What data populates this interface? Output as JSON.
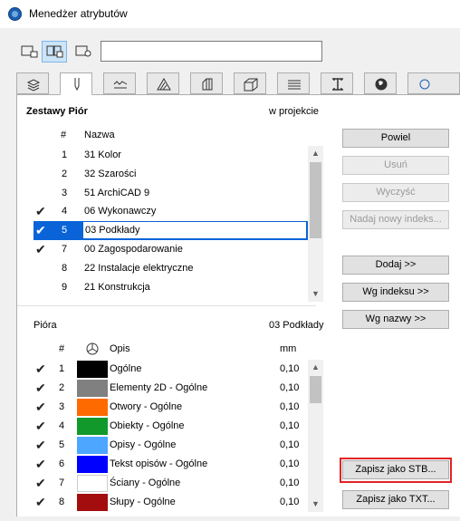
{
  "window": {
    "title": "Menedżer atrybutów"
  },
  "search": {
    "value": "",
    "placeholder": ""
  },
  "tabs": [
    {
      "icon": "layers-icon"
    },
    {
      "icon": "pen-icon",
      "active": true
    },
    {
      "icon": "line-type-icon"
    },
    {
      "icon": "fill-icon"
    },
    {
      "icon": "composite-icon"
    },
    {
      "icon": "building-material-icon"
    },
    {
      "icon": "surface-icon"
    },
    {
      "icon": "profile-icon"
    },
    {
      "icon": "globe-icon"
    }
  ],
  "pensets": {
    "header": "Zestawy Piór",
    "header_right": "w projekcie",
    "col_num": "#",
    "col_name": "Nazwa",
    "rows": [
      {
        "num": "1",
        "name": "31 Kolor",
        "checked": false
      },
      {
        "num": "2",
        "name": "32 Szarości",
        "checked": false
      },
      {
        "num": "3",
        "name": "51 ArchiCAD 9",
        "checked": false
      },
      {
        "num": "4",
        "name": "06 Wykonawczy",
        "checked": true
      },
      {
        "num": "5",
        "name": "03 Podkłady",
        "checked": true,
        "selected": true
      },
      {
        "num": "7",
        "name": "00 Zagospodarowanie",
        "checked": true
      },
      {
        "num": "8",
        "name": "22 Instalacje elektryczne",
        "checked": false
      },
      {
        "num": "9",
        "name": "21 Konstrukcja",
        "checked": false
      }
    ]
  },
  "pens": {
    "header": "Pióra",
    "header_right": "03 Podkłady",
    "col_num": "#",
    "col_desc": "Opis",
    "col_mm": "mm",
    "rows": [
      {
        "num": "1",
        "color": "#000000",
        "desc": "Ogólne",
        "mm": "0,10"
      },
      {
        "num": "2",
        "color": "#808080",
        "desc": "Elementy 2D - Ogólne",
        "mm": "0,10"
      },
      {
        "num": "3",
        "color": "#ff6a00",
        "desc": "Otwory - Ogólne",
        "mm": "0,10"
      },
      {
        "num": "4",
        "color": "#119a2b",
        "desc": "Obiekty - Ogólne",
        "mm": "0,10"
      },
      {
        "num": "5",
        "color": "#4da6ff",
        "desc": "Opisy - Ogólne",
        "mm": "0,10"
      },
      {
        "num": "6",
        "color": "#0000ff",
        "desc": "Tekst opisów - Ogólne",
        "mm": "0,10"
      },
      {
        "num": "7",
        "color": "#ffffff",
        "desc": "Ściany - Ogólne",
        "mm": "0,10"
      },
      {
        "num": "8",
        "color": "#a30d0d",
        "desc": "Słupy - Ogólne",
        "mm": "0,10"
      }
    ]
  },
  "buttons": {
    "duplicate": "Powiel",
    "delete": "Usuń",
    "clear": "Wyczyść",
    "renumber": "Nadaj nowy indeks...",
    "add": "Dodaj >>",
    "by_index": "Wg indeksu >>",
    "by_name": "Wg nazwy >>",
    "save_stb": "Zapisz jako STB...",
    "save_txt": "Zapisz jako TXT..."
  },
  "colors": {
    "selection": "#0a64d8",
    "highlight": "#e02424"
  }
}
